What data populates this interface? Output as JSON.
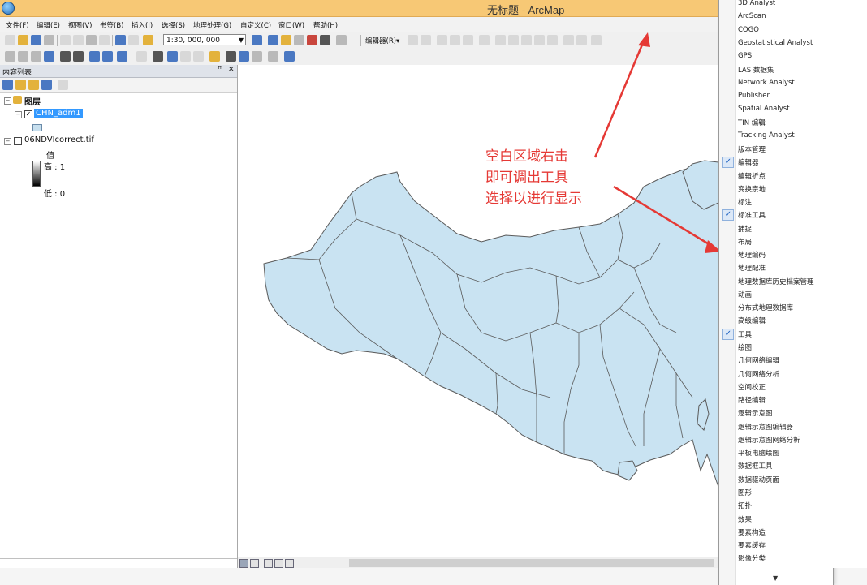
{
  "window": {
    "title": "无标题 - ArcMap"
  },
  "menubar": {
    "items": [
      "文件(F)",
      "编辑(E)",
      "视图(V)",
      "书签(B)",
      "插入(I)",
      "选择(S)",
      "地理处理(G)",
      "自定义(C)",
      "窗口(W)",
      "帮助(H)"
    ]
  },
  "toolbar": {
    "scale": "1:30, 000, 000",
    "editor_label": "编辑器(R)▾"
  },
  "toc": {
    "title": "内容列表",
    "pin": "ꟸ",
    "close": "✕",
    "root_label": "图层",
    "layers": [
      {
        "name": "CHN_adm1",
        "checked": true,
        "selected": true
      },
      {
        "name": "06NDVIcorrect.tif",
        "checked": false,
        "selected": false
      }
    ],
    "legend": {
      "value_label": "值",
      "high": "高 : 1",
      "low": "低 : 0"
    }
  },
  "annotation": {
    "lines": [
      "空白区域右击",
      "即可调出工具",
      "选择以进行显示"
    ],
    "color": "#e53935"
  },
  "context_menu": {
    "items": [
      {
        "label": "3D Analyst",
        "checked": false
      },
      {
        "label": "ArcScan",
        "checked": false
      },
      {
        "label": "COGO",
        "checked": false
      },
      {
        "label": "Geostatistical Analyst",
        "checked": false
      },
      {
        "label": "GPS",
        "checked": false
      },
      {
        "label": "LAS 数据集",
        "checked": false
      },
      {
        "label": "Network Analyst",
        "checked": false
      },
      {
        "label": "Publisher",
        "checked": false
      },
      {
        "label": "Spatial Analyst",
        "checked": false
      },
      {
        "label": "TIN 编辑",
        "checked": false
      },
      {
        "label": "Tracking Analyst",
        "checked": false
      },
      {
        "label": "版本管理",
        "checked": false
      },
      {
        "label": "编辑器",
        "checked": true
      },
      {
        "label": "编辑折点",
        "checked": false
      },
      {
        "label": "变换宗地",
        "checked": false
      },
      {
        "label": "标注",
        "checked": false
      },
      {
        "label": "标准工具",
        "checked": true
      },
      {
        "label": "捕捉",
        "checked": false
      },
      {
        "label": "布局",
        "checked": false
      },
      {
        "label": "地理编码",
        "checked": false
      },
      {
        "label": "地理配准",
        "checked": false
      },
      {
        "label": "地理数据库历史档案管理",
        "checked": false
      },
      {
        "label": "动画",
        "checked": false
      },
      {
        "label": "分布式地理数据库",
        "checked": false
      },
      {
        "label": "高级编辑",
        "checked": false
      },
      {
        "label": "工具",
        "checked": true
      },
      {
        "label": "绘图",
        "checked": false
      },
      {
        "label": "几何网络编辑",
        "checked": false
      },
      {
        "label": "几何网络分析",
        "checked": false
      },
      {
        "label": "空间校正",
        "checked": false
      },
      {
        "label": "路径编辑",
        "checked": false
      },
      {
        "label": "逻辑示意图",
        "checked": false
      },
      {
        "label": "逻辑示意图编辑器",
        "checked": false
      },
      {
        "label": "逻辑示意图网络分析",
        "checked": false
      },
      {
        "label": "平板电脑绘图",
        "checked": false
      },
      {
        "label": "数据框工具",
        "checked": false
      },
      {
        "label": "数据驱动页面",
        "checked": false
      },
      {
        "label": "图形",
        "checked": false
      },
      {
        "label": "拓扑",
        "checked": false
      },
      {
        "label": "效果",
        "checked": false
      },
      {
        "label": "要素构造",
        "checked": false
      },
      {
        "label": "要素缓存",
        "checked": false
      },
      {
        "label": "影像分类",
        "checked": false
      }
    ],
    "more_arrow": "▼"
  },
  "colors": {
    "titlebar": "#f7c875",
    "map_fill": "#c9e3f2",
    "map_stroke": "#5a5a5a"
  }
}
